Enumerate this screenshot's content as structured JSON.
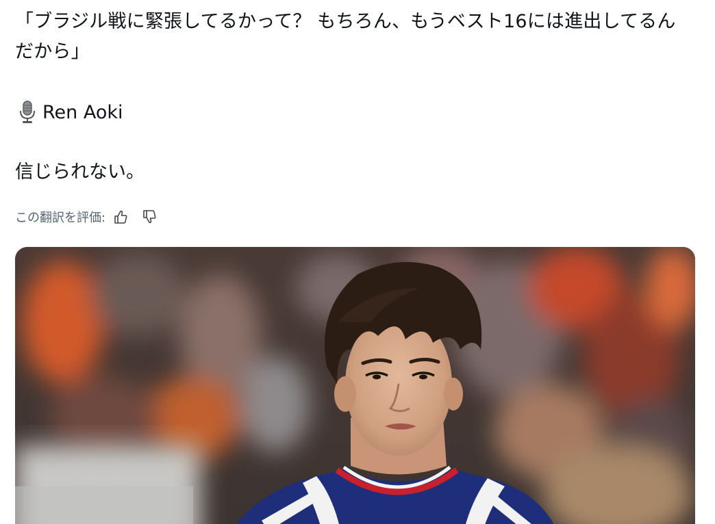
{
  "post": {
    "quote_text": "「ブラジル戦に緊張してるかって？ もちろん、もうベスト16には進出してるんだから」",
    "author_name": "Ren Aoki",
    "author_icon": "microphone-icon",
    "comment": "信じられない。"
  },
  "translation_rating": {
    "label": "この翻訳を評価:",
    "good_icon": "thumbs-up-icon",
    "bad_icon": "thumbs-down-icon"
  },
  "media": {
    "kind": "photo",
    "subject": "player-portrait"
  },
  "colors": {
    "text": "#0f1419",
    "muted": "#536471",
    "kit_blue": "#1f2e7a",
    "kit_red": "#c8202c"
  }
}
